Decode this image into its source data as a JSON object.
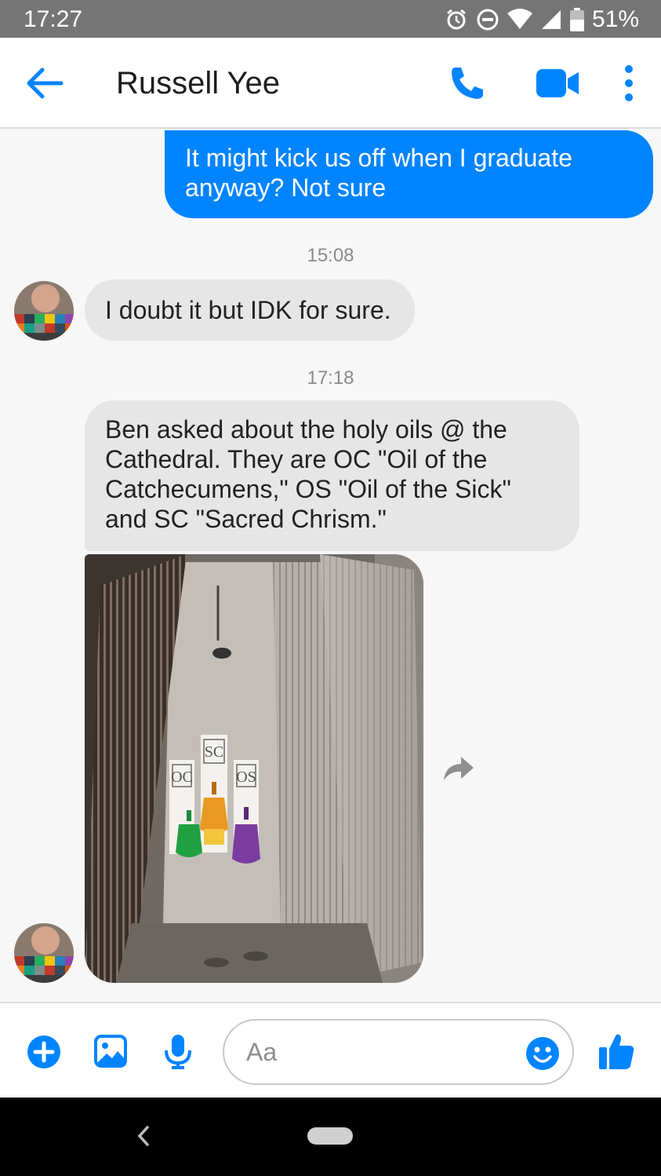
{
  "status_bar": {
    "time": "17:27",
    "battery": "51%",
    "icons": [
      "alarm-icon",
      "do-not-disturb-icon",
      "wifi-icon",
      "signal-icon",
      "battery-icon"
    ]
  },
  "header": {
    "contact_name": "Russell Yee",
    "icons": [
      "back-arrow-icon",
      "phone-icon",
      "video-camera-icon",
      "more-vert-icon"
    ]
  },
  "messages": {
    "sent_1": "It might kick us off when I graduate anyway? Not sure",
    "timestamp_1": "15:08",
    "received_1": "I doubt it but IDK for sure.",
    "timestamp_2": "17:18",
    "received_2": "Ben asked about the holy oils @ the Cathedral. They are OC \"Oil of the Catchecumens,\" OS \"Oil of the Sick\" and SC \"Sacred Chrism.\"",
    "photo_labels": {
      "left": "OC",
      "center": "SC",
      "right": "OS"
    }
  },
  "composer": {
    "placeholder": "Aa",
    "icons": [
      "add-icon",
      "gallery-icon",
      "microphone-icon",
      "emoji-icon",
      "thumbs-up-icon"
    ]
  },
  "colors": {
    "accent": "#0084ff",
    "sent_bubble": "#0084ff",
    "received_bubble": "#e6e6e6",
    "status_bar": "#757575"
  }
}
